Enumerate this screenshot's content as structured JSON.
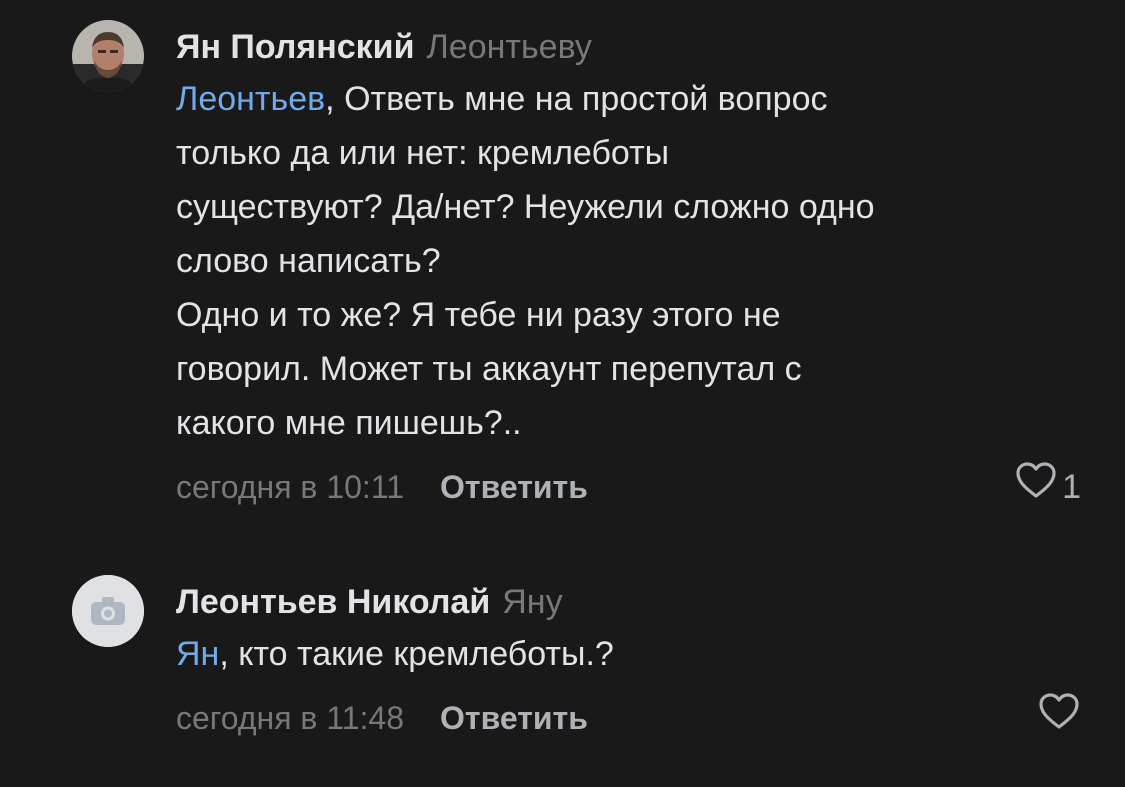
{
  "comments": [
    {
      "author": "Ян Полянский",
      "reply_to": "Леонтьеву",
      "mention": "Леонтьев",
      "text": ", Ответь мне на простой вопрос\nтолько да или нет: кремлеботы\nсуществуют? Да/нет? Неужели сложно одно\nслово написать?\nОдно и то же? Я тебе ни разу этого не\nговорил. Может ты аккаунт перепутал с\nкакого мне пишешь?..",
      "time": "сегодня в 10:11",
      "reply_label": "Ответить",
      "like_icon": "heart-outline-icon",
      "likes": "1",
      "avatar": "user-photo"
    },
    {
      "author": "Леонтьев Николай",
      "reply_to": "Яну",
      "mention": "Ян",
      "text": ", кто такие кремлеботы.?",
      "time": "сегодня в 11:48",
      "reply_label": "Ответить",
      "like_icon": "heart-outline-icon",
      "avatar": "camera-placeholder-icon"
    }
  ],
  "colors": {
    "background": "#19191a",
    "text": "#e1e3e6",
    "secondary": "#76787a",
    "mention": "#71aaeb",
    "action": "#aeb1b5"
  }
}
